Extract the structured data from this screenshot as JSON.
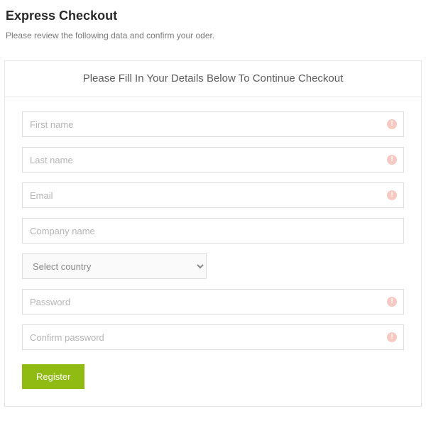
{
  "page": {
    "title": "Express Checkout",
    "subtext": "Please review the following data and confirm your oder."
  },
  "panel": {
    "title": "Please Fill In Your Details Below To Continue Checkout"
  },
  "form": {
    "first_name": {
      "placeholder": "First name",
      "value": ""
    },
    "last_name": {
      "placeholder": "Last name",
      "value": ""
    },
    "email": {
      "placeholder": "Email",
      "value": ""
    },
    "company": {
      "placeholder": "Company name",
      "value": ""
    },
    "country": {
      "placeholder": "Select country",
      "value": ""
    },
    "password": {
      "placeholder": "Password",
      "value": ""
    },
    "confirm_password": {
      "placeholder": "Confirm password",
      "value": ""
    },
    "submit_label": "Register"
  },
  "icons": {
    "required_glyph": "!"
  },
  "colors": {
    "accent": "#8fbb12",
    "required_badge": "#f6c9c2"
  }
}
